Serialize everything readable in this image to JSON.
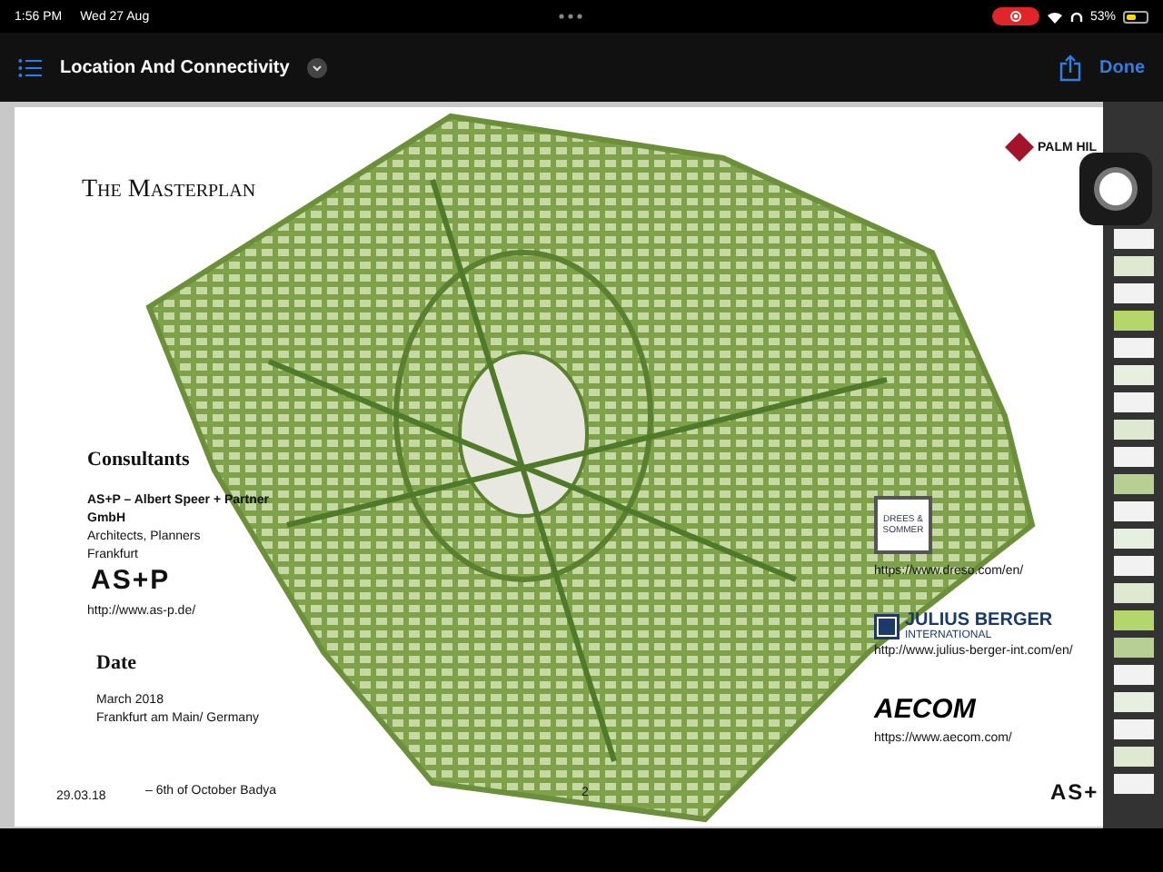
{
  "status_bar": {
    "time": "1:56 PM",
    "date": "Wed 27 Aug",
    "battery": "53%"
  },
  "nav_bar": {
    "title": "Location And Connectivity",
    "done": "Done"
  },
  "slide": {
    "title": "The Masterplan",
    "logo_text": "PALM HIL",
    "consultants_heading": "Consultants",
    "firm": "AS+P – Albert Speer + Partner GmbH",
    "firm_lines": [
      "Architects, Planners",
      "Frankfurt"
    ],
    "firm_logo": "AS+P",
    "firm_url": "http://www.as-p.de/",
    "date_heading": "Date",
    "date_lines": [
      "March 2018",
      "Frankfurt am Main/ Germany"
    ],
    "partners": [
      {
        "kind": "box",
        "logo": "DREES & SOMMER",
        "url": "https://www.dreso.com/en/"
      },
      {
        "kind": "badge",
        "logo": "JULIUS BERGER",
        "sub": "INTERNATIONAL",
        "url": "http://www.julius-berger-int.com/en/"
      },
      {
        "kind": "word",
        "logo": "AECOM",
        "url": "https://www.aecom.com/"
      }
    ],
    "footer_date": "29.03.18",
    "footer_text": "– 6th of October Badya",
    "page_number": "2",
    "footer_logo": "AS+"
  }
}
